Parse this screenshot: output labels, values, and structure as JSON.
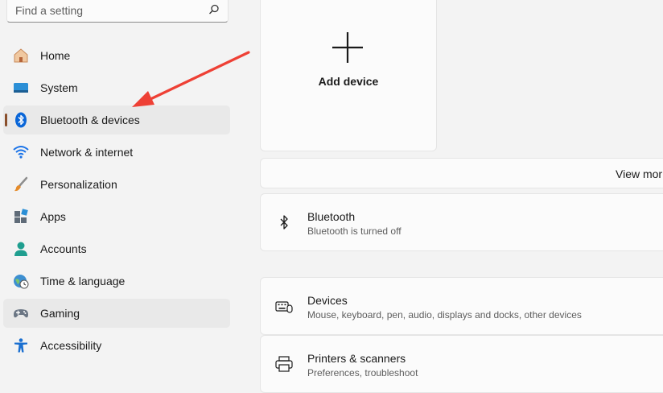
{
  "search": {
    "placeholder": "Find a setting"
  },
  "sidebar": {
    "items": [
      {
        "label": "Home"
      },
      {
        "label": "System"
      },
      {
        "label": "Bluetooth & devices"
      },
      {
        "label": "Network & internet"
      },
      {
        "label": "Personalization"
      },
      {
        "label": "Apps"
      },
      {
        "label": "Accounts"
      },
      {
        "label": "Time & language"
      },
      {
        "label": "Gaming"
      },
      {
        "label": "Accessibility"
      }
    ],
    "selected_index": 2
  },
  "main": {
    "add_device_label": "Add device",
    "view_more_label": "View mor",
    "bluetooth": {
      "title": "Bluetooth",
      "subtitle": "Bluetooth is turned off"
    },
    "devices": {
      "title": "Devices",
      "subtitle": "Mouse, keyboard, pen, audio, displays and docks, other devices"
    },
    "printers": {
      "title": "Printers & scanners",
      "subtitle": "Preferences, troubleshoot"
    }
  },
  "colors": {
    "accent": "#8a4f2b",
    "annotation_arrow": "#ee4035",
    "wifi": "#1a73e8",
    "bluetooth": "#0a66d8"
  }
}
